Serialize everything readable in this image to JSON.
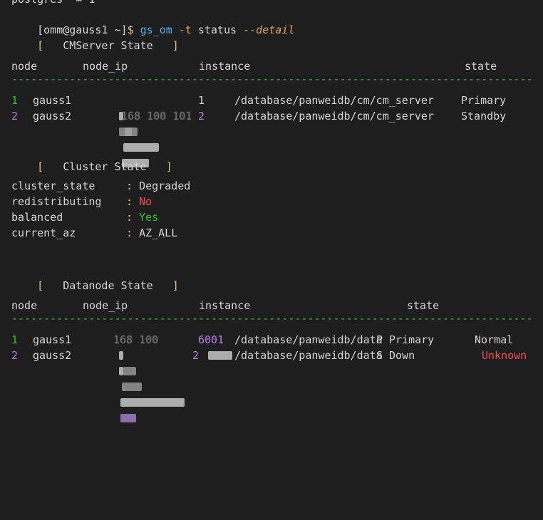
{
  "prompt": {
    "user_host": "[omm@gauss1 ~]",
    "symbol": "$",
    "command": "gs_om",
    "flag": "-t",
    "arg": "status",
    "option": "--detail"
  },
  "cut_top_text": "postgres  = 1",
  "cmserver": {
    "header": "[   CMServer State   ]",
    "columns": [
      "node",
      "node_ip",
      "instance",
      "state"
    ],
    "rows": [
      {
        "index": "1",
        "node": "gauss1",
        "ip_tail": "1",
        "instance": "/database/panweidb/cm/cm_server",
        "state": "Primary"
      },
      {
        "index": "2",
        "node": "gauss2",
        "ip_mid": "168 100 101",
        "ip_tail": "2",
        "instance": "/database/panweidb/cm/cm_server",
        "state": "Standby"
      }
    ]
  },
  "cluster": {
    "header": "[   Cluster State   ]",
    "items": [
      {
        "key": "cluster_state",
        "value": "Degraded"
      },
      {
        "key": "redistributing",
        "value": "No"
      },
      {
        "key": "balanced",
        "value": "Yes"
      },
      {
        "key": "current_az",
        "value": "AZ_ALL"
      }
    ]
  },
  "datanode": {
    "header": "[   Datanode State   ]",
    "columns": [
      "node",
      "node_ip",
      "instance",
      "state"
    ],
    "rows": [
      {
        "index": "1",
        "node": "gauss1",
        "ip_mid": "168 100",
        "port": "6001",
        "instance": "/database/panweidb/data",
        "role": "P",
        "role_state": "Primary",
        "state": "Normal"
      },
      {
        "index": "2",
        "node": "gauss2",
        "port": "2",
        "instance": "/database/panweidb/data",
        "role": "S",
        "role_state": "Down",
        "state": "Unknown"
      }
    ]
  },
  "separator": "------------------------------------------------------------------------------------------------------------------------"
}
